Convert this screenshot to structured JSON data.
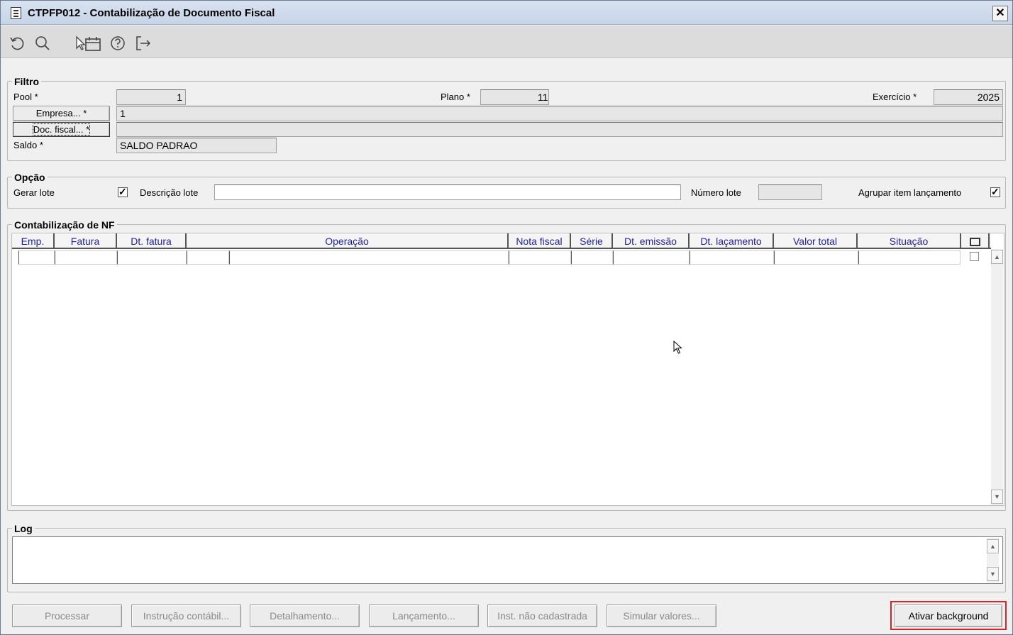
{
  "window": {
    "title": "CTPFP012 - Contabilização de Documento Fiscal",
    "close_label": "✕"
  },
  "toolbar": {
    "icons": [
      "undo-icon",
      "search-icon",
      "select-calendar-icon",
      "help-icon",
      "exit-icon"
    ]
  },
  "filtro": {
    "legend": "Filtro",
    "pool_label": "Pool *",
    "pool_value": "1",
    "plano_label": "Plano *",
    "plano_value": "11",
    "exercicio_label": "Exercício *",
    "exercicio_value": "2025",
    "empresa_button": "Empresa... *",
    "empresa_value": "1",
    "doc_fiscal_button": "Doc. fiscal... *",
    "doc_fiscal_value": "",
    "saldo_label": "Saldo *",
    "saldo_value": "SALDO PADRAO"
  },
  "opcao": {
    "legend": "Opção",
    "gerar_lote_label": "Gerar lote",
    "gerar_lote_checked": true,
    "descricao_lote_label": "Descrição lote",
    "descricao_lote_value": "",
    "numero_lote_label": "Número lote",
    "numero_lote_value": "",
    "agrupar_label": "Agrupar item lançamento",
    "agrupar_checked": true
  },
  "contabilizacao": {
    "legend": "Contabilização de NF",
    "columns": [
      "Emp.",
      "Fatura",
      "Dt. fatura",
      "Operação",
      "Nota fiscal",
      "Série",
      "Dt. emissão",
      "Dt. laçamento",
      "Valor total",
      "Situação"
    ]
  },
  "log": {
    "legend": "Log",
    "text": ""
  },
  "buttons": {
    "processar": "Processar",
    "instrucao": "Instrução contábil...",
    "detalhamento": "Detalhamento...",
    "lancamento": "Lançamento...",
    "inst_nao_cadastrada": "Inst. não cadastrada",
    "simular": "Simular valores...",
    "ativar": "Ativar background"
  }
}
